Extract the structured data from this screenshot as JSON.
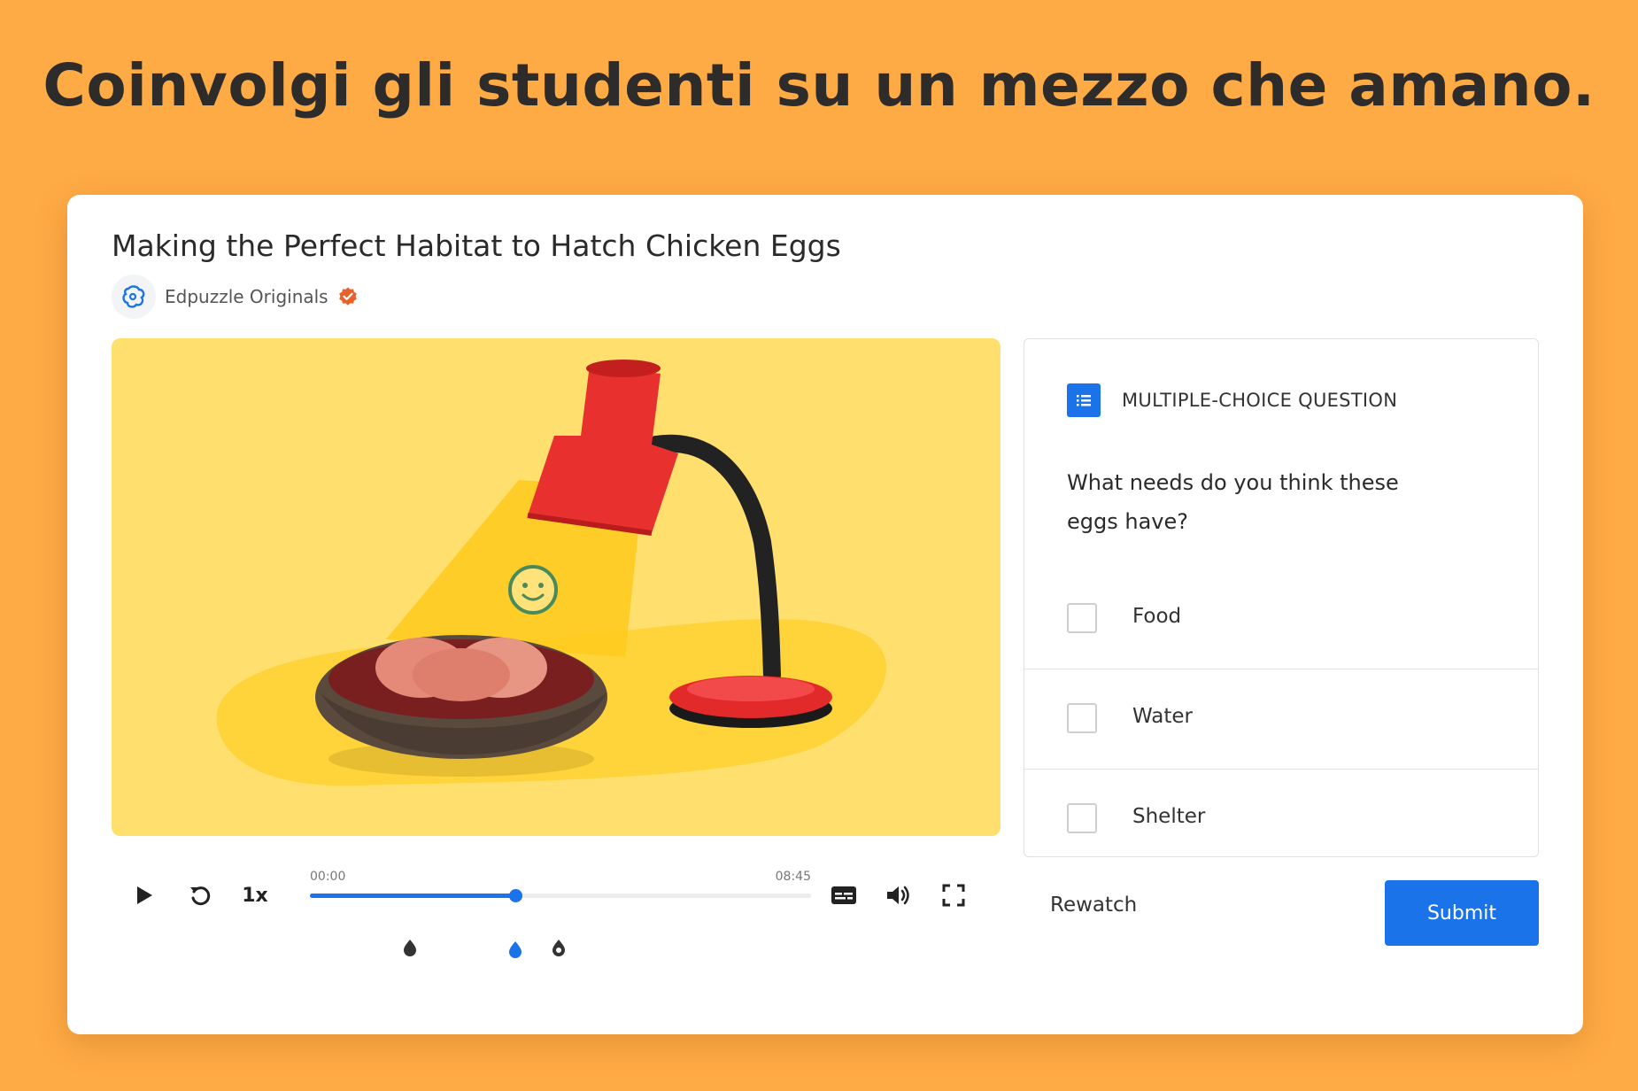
{
  "headline": "Coinvolgi gli studenti su un mezzo che amano.",
  "video": {
    "title": "Making the Perfect Habitat to Hatch Chicken Eggs",
    "channel": "Edpuzzle Originals",
    "time_start": "00:00",
    "time_end": "08:45",
    "speed": "1x",
    "progress": 0.41
  },
  "question": {
    "type_label": "MULTIPLE-CHOICE QUESTION",
    "text": "What needs do you think these eggs have?",
    "options": [
      "Food",
      "Water",
      "Shelter"
    ]
  },
  "actions": {
    "rewatch": "Rewatch",
    "submit": "Submit"
  },
  "colors": {
    "background": "#FFAB45",
    "accent": "#1a73e8",
    "verified": "#E8602A",
    "video_bg": "#FFDF6E"
  },
  "icons": {
    "play": "play-icon",
    "rewind": "rewind-icon",
    "captions": "captions-icon",
    "volume": "volume-icon",
    "fullscreen": "fullscreen-icon",
    "question_type": "list-icon"
  }
}
